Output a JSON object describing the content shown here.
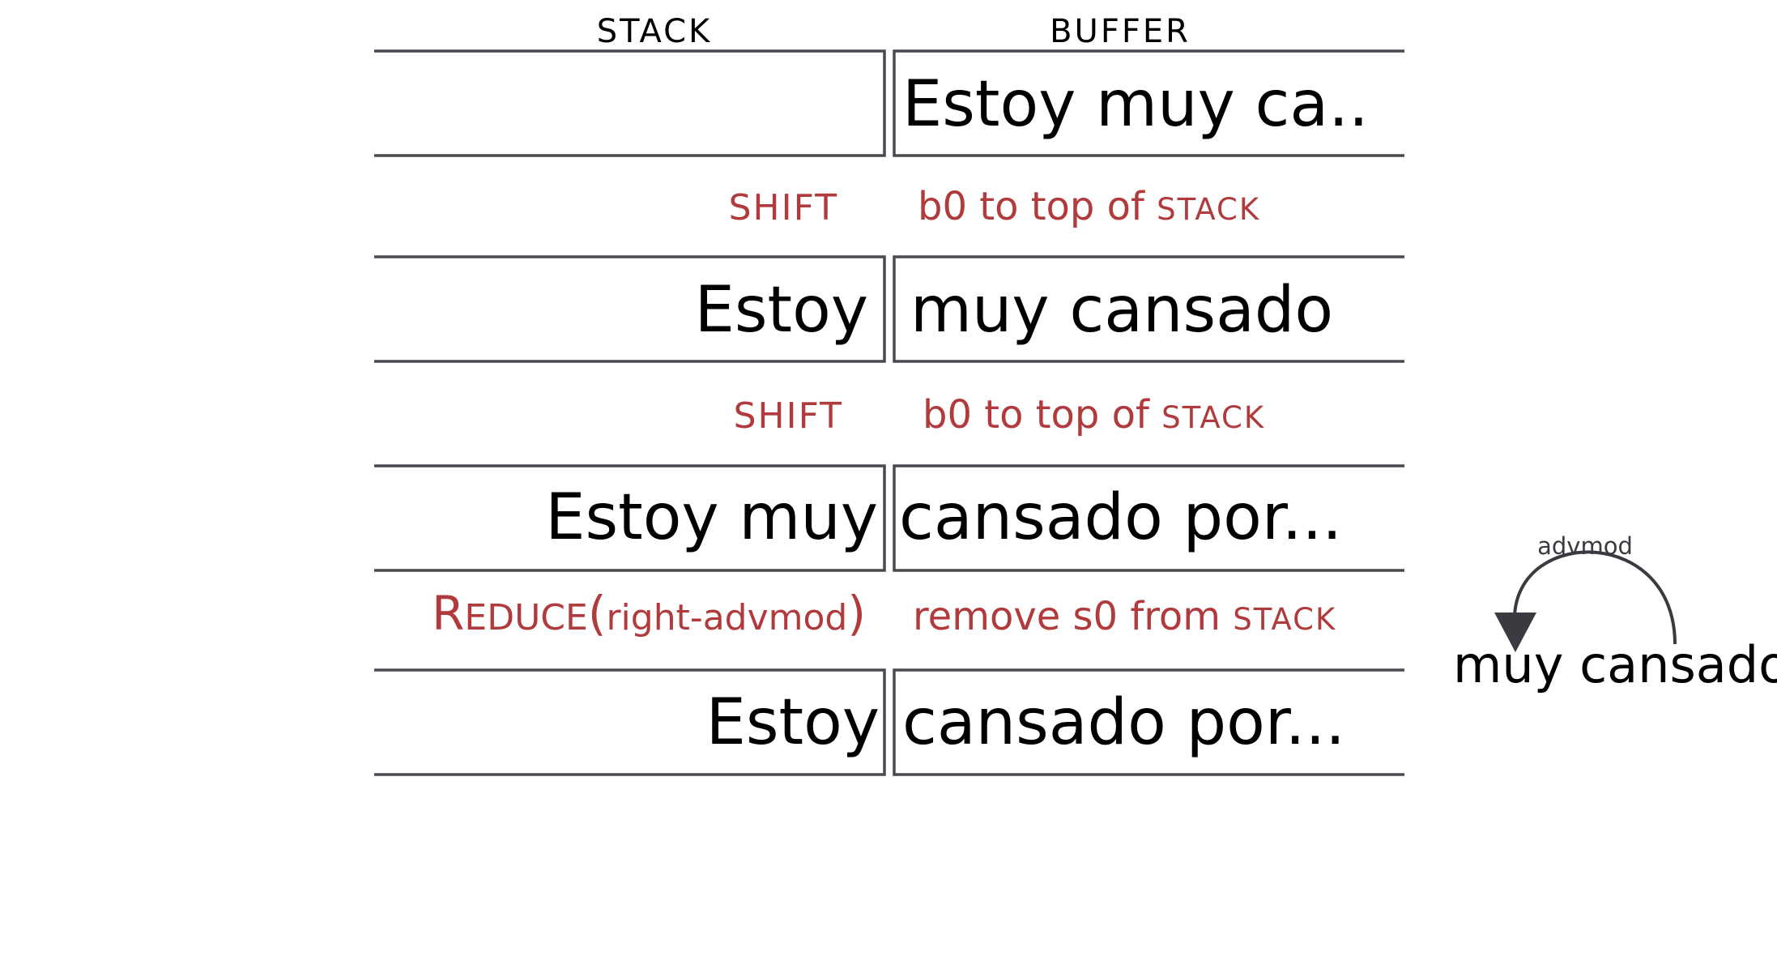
{
  "header": {
    "stack": "STACK",
    "buffer": "BUFFER"
  },
  "configs": [
    {
      "stack": "",
      "buffer": "Estoy muy ca.."
    },
    {
      "stack": "Estoy",
      "buffer": "muy cansado"
    },
    {
      "stack": "Estoy muy",
      "buffer": "cansado por..."
    },
    {
      "stack": "Estoy",
      "buffer": "cansado por..."
    }
  ],
  "transitions": [
    {
      "action": "SHIFT",
      "description": {
        "prefix": "b0 to top of ",
        "smallcaps": "STACK"
      }
    },
    {
      "action": "SHIFT",
      "description": {
        "prefix": "b0 to top of ",
        "smallcaps": "STACK"
      }
    },
    {
      "action": {
        "first_letter": "R",
        "rest": "EDUCE",
        "open": "(",
        "arg": "right-advmod",
        "close": ")"
      },
      "description": {
        "prefix": "remove s0 from ",
        "smallcaps": "STACK"
      }
    }
  ],
  "arc": {
    "label": "advmod",
    "head": "cansado",
    "dependent": "muy",
    "phrase": "muy cansado"
  },
  "colors": {
    "box": "#4a4950",
    "text": "#000000",
    "action": "#b03a3c",
    "arc": "#3a3a40"
  }
}
